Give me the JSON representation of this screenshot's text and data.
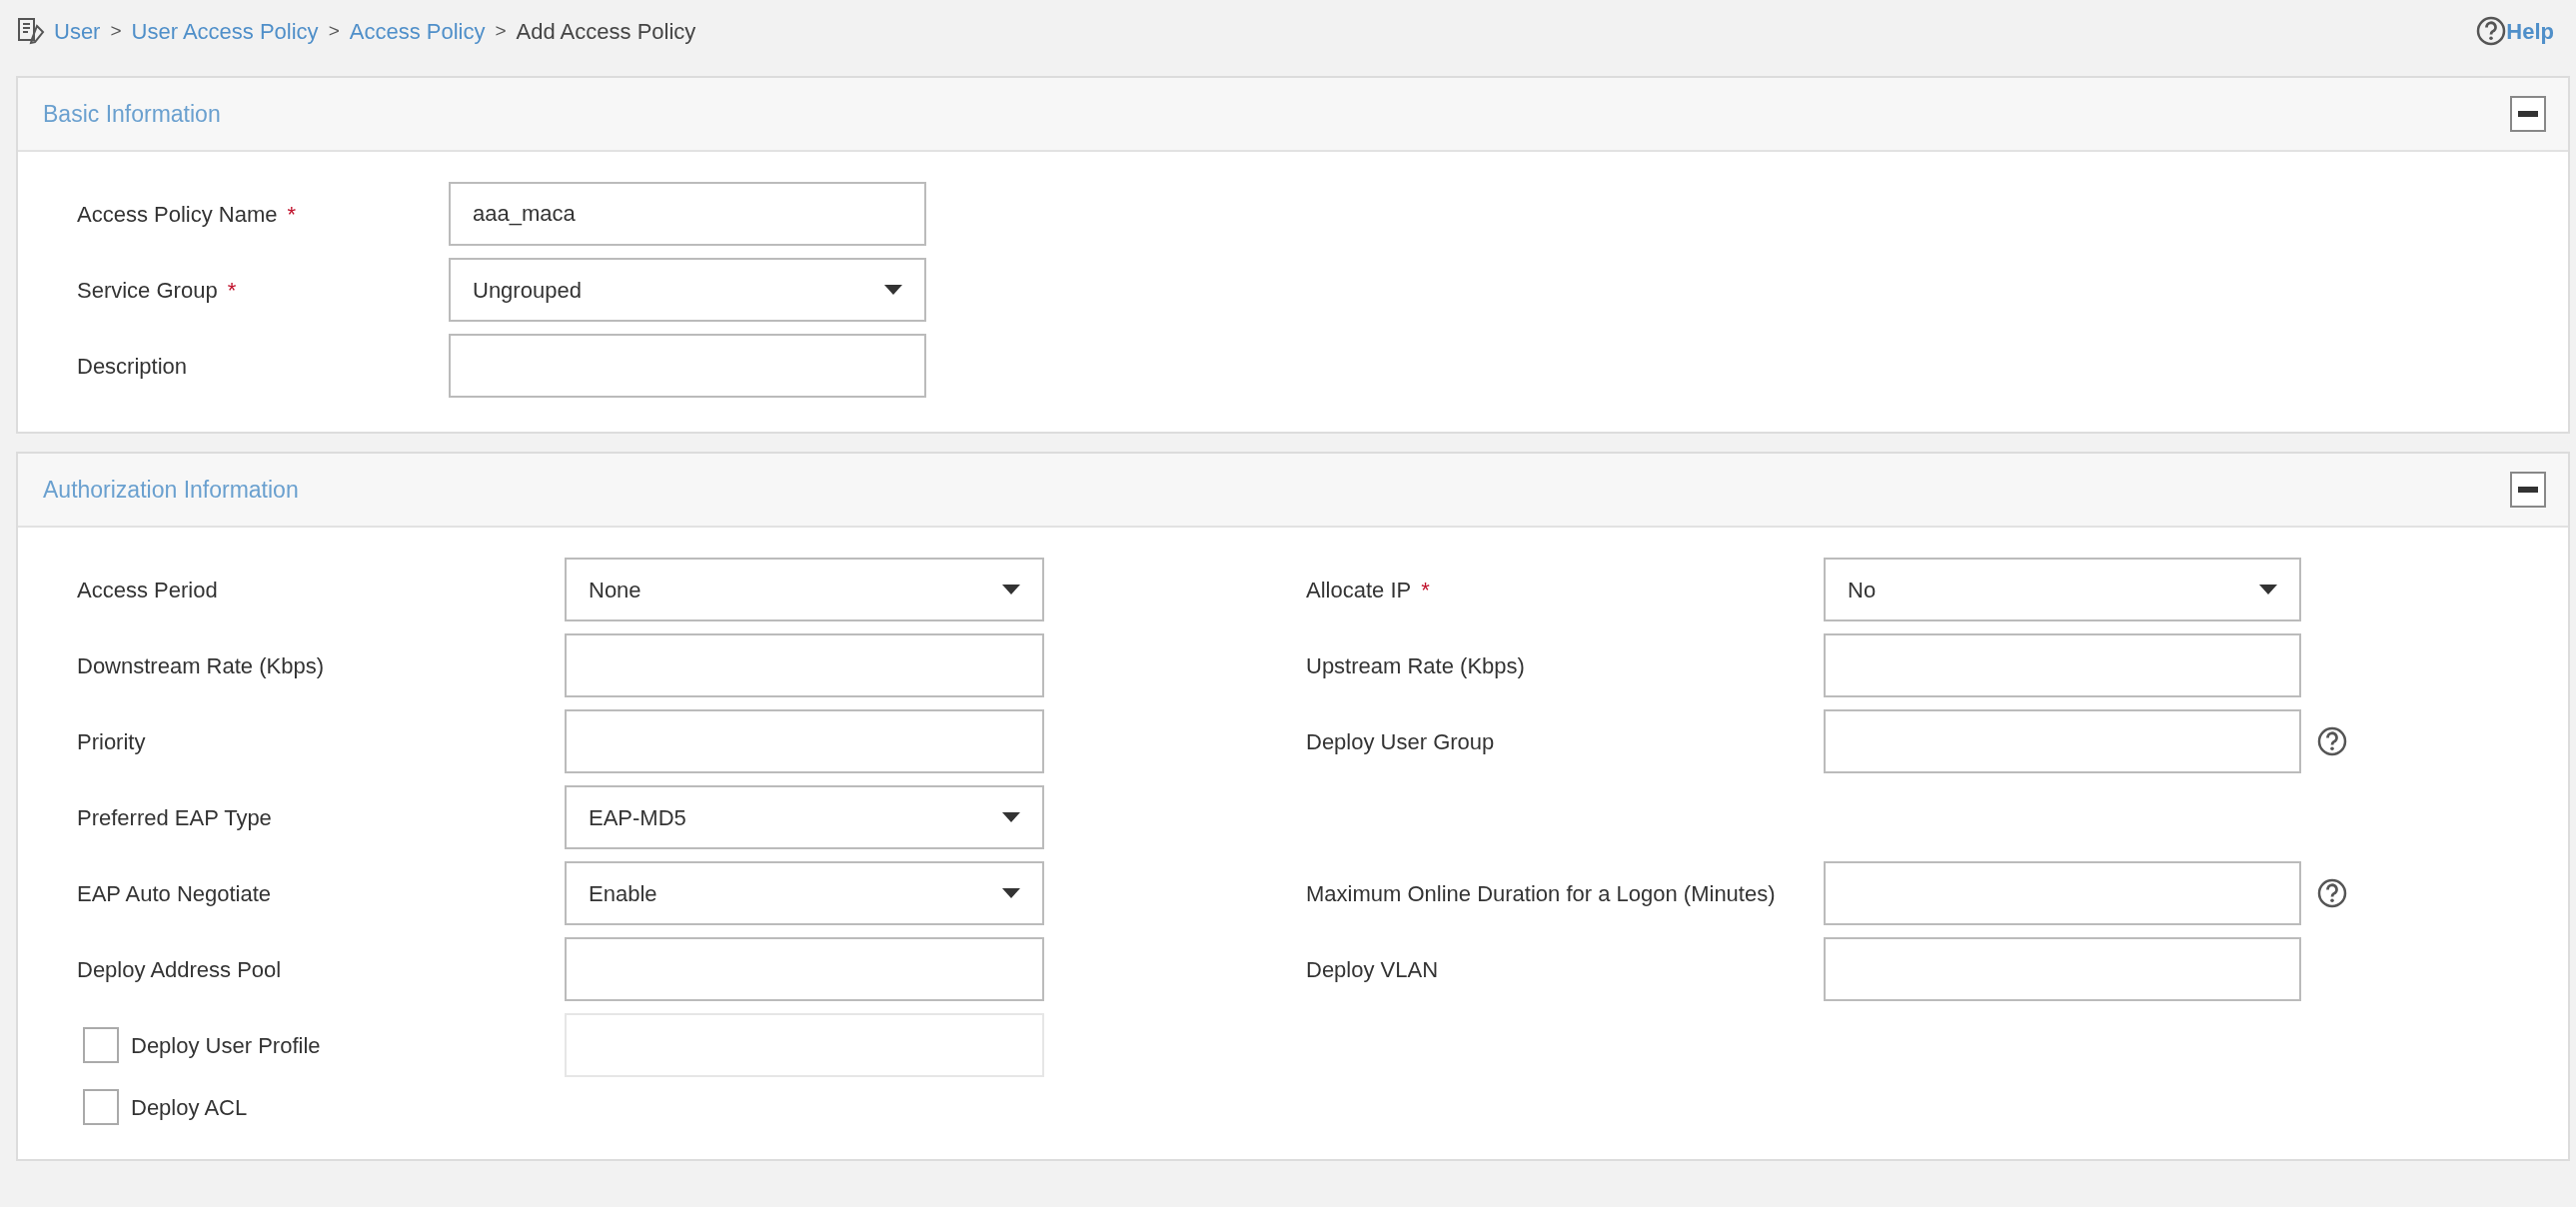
{
  "breadcrumb": [
    {
      "kind": "link",
      "label": "User"
    },
    {
      "kind": "separator",
      "label": ">"
    },
    {
      "kind": "link",
      "label": "User Access Policy"
    },
    {
      "kind": "separator",
      "label": ">"
    },
    {
      "kind": "link",
      "label": "Access Policy"
    },
    {
      "kind": "separator",
      "label": ">"
    },
    {
      "kind": "current",
      "label": "Add Access Policy"
    }
  ],
  "help": {
    "label": "Help"
  },
  "sections": [
    {
      "title": "Basic Information",
      "expanded": true,
      "rows": [
        {
          "left": {
            "kind": "text",
            "label": "Access Policy Name",
            "marker": "*",
            "value": "aaa_maca"
          }
        },
        {
          "left": {
            "kind": "select",
            "label": "Service Group",
            "marker": "*",
            "value": "Ungrouped"
          }
        },
        {
          "left": {
            "kind": "text",
            "label": "Description"
          }
        }
      ]
    },
    {
      "title": "Authorization Information",
      "expanded": true,
      "rows": [
        {
          "left": {
            "kind": "select",
            "label": "Access Period",
            "value": "None"
          },
          "right": {
            "kind": "select",
            "label": "Allocate IP",
            "marker": "*",
            "value": "No"
          }
        },
        {
          "left": {
            "kind": "text",
            "label": "Downstream Rate (Kbps)"
          },
          "right": {
            "kind": "text",
            "label": "Upstream Rate (Kbps)"
          }
        },
        {
          "left": {
            "kind": "text",
            "label": "Priority"
          },
          "right": {
            "kind": "text",
            "label": "Deploy User Group",
            "help": true
          }
        },
        {
          "left": {
            "kind": "select",
            "label": "Preferred EAP Type",
            "value": "EAP-MD5"
          }
        },
        {
          "left": {
            "kind": "select",
            "label": "EAP Auto Negotiate",
            "value": "Enable"
          },
          "right": {
            "kind": "text",
            "label": "Maximum Online Duration for a Logon (Minutes)",
            "help": true
          }
        },
        {
          "left": {
            "kind": "text",
            "label": "Deploy Address Pool"
          },
          "right": {
            "kind": "text",
            "label": "Deploy VLAN"
          }
        },
        {
          "left": {
            "kind": "checkbox",
            "label": "Deploy User Profile",
            "checked": false,
            "field": {
              "disabled": true
            }
          }
        },
        {
          "left": {
            "kind": "checkbox",
            "label": "Deploy ACL",
            "checked": false
          }
        }
      ]
    }
  ]
}
